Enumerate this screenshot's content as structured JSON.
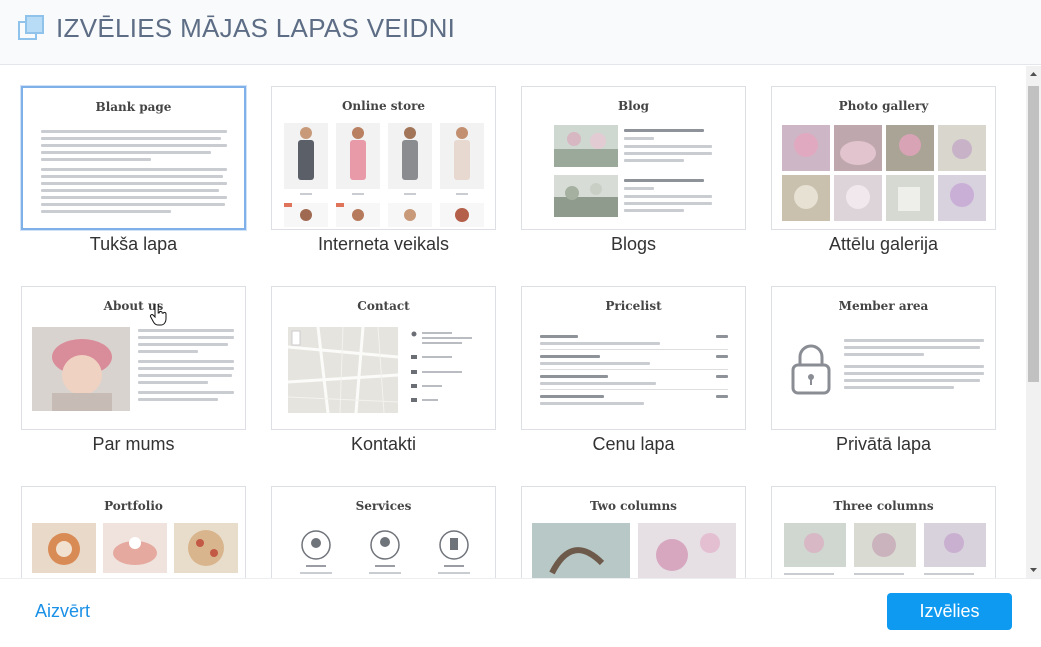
{
  "header": {
    "title": "IZVĒLIES MĀJAS LAPAS VEIDNI",
    "icon": "copy-pages-icon"
  },
  "templates": [
    {
      "preview_title": "Blank page",
      "caption": "Tukša lapa"
    },
    {
      "preview_title": "Online store",
      "caption": "Interneta veikals"
    },
    {
      "preview_title": "Blog",
      "caption": "Blogs"
    },
    {
      "preview_title": "Photo gallery",
      "caption": "Attēlu galerija"
    },
    {
      "preview_title": "About us",
      "caption": "Par mums"
    },
    {
      "preview_title": "Contact",
      "caption": "Kontakti"
    },
    {
      "preview_title": "Pricelist",
      "caption": "Cenu lapa"
    },
    {
      "preview_title": "Member area",
      "caption": "Privātā lapa"
    },
    {
      "preview_title": "Portfolio",
      "caption": ""
    },
    {
      "preview_title": "Services",
      "caption": ""
    },
    {
      "preview_title": "Two columns",
      "caption": ""
    },
    {
      "preview_title": "Three columns",
      "caption": ""
    }
  ],
  "footer": {
    "close_label": "Aizvērt",
    "choose_label": "Izvēlies"
  },
  "colors": {
    "accent": "#0d9af0",
    "link": "#1a90e6",
    "title": "#5d6d85",
    "selected_border": "#7fb0e8"
  }
}
